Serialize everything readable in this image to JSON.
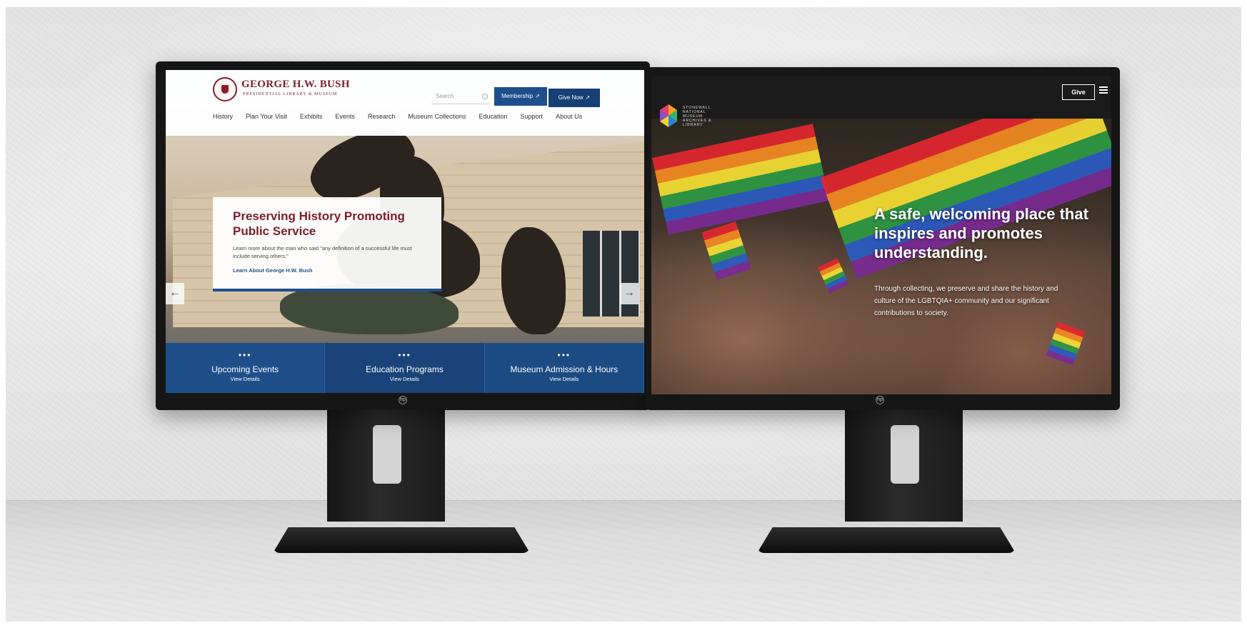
{
  "left_site": {
    "brand": {
      "title": "GEORGE H.W. BUSH",
      "subtitle": "PRESIDENTIAL LIBRARY & MUSEUM"
    },
    "search": {
      "placeholder": "Search"
    },
    "buttons": {
      "membership": "Membership",
      "give_now": "Give Now"
    },
    "nav": [
      "History",
      "Plan Your Visit",
      "Exhibits",
      "Events",
      "Research",
      "Museum Collections",
      "Education",
      "Support",
      "About Us"
    ],
    "hero": {
      "title": "Preserving History Promoting Public Service",
      "body": "Learn more about the man who said \"any definition of a successful life must include serving others.\"",
      "link": "Learn About George H.W. Bush",
      "prev_arrow": "←",
      "next_arrow": "→"
    },
    "quick_links": [
      {
        "dots": "•••",
        "title": "Upcoming Events",
        "sub": "View Details"
      },
      {
        "dots": "•••",
        "title": "Education Programs",
        "sub": "View Details"
      },
      {
        "dots": "•••",
        "title": "Museum Admission & Hours",
        "sub": "View Details"
      }
    ]
  },
  "right_site": {
    "logo_text": "STONEWALL NATIONAL MUSEUM ARCHIVES & LIBRARY",
    "give_label": "Give",
    "hero": {
      "title": "A safe, welcoming place that inspires and promotes understanding.",
      "body": "Through collecting, we preserve and share the history and culture of the LGBTQIA+ community and our significant contributions to society."
    }
  },
  "colors": {
    "bush_maroon": "#7c1d2b",
    "bush_blue": "#1e4e8c",
    "stonewall_dark": "#1b1b1b"
  }
}
